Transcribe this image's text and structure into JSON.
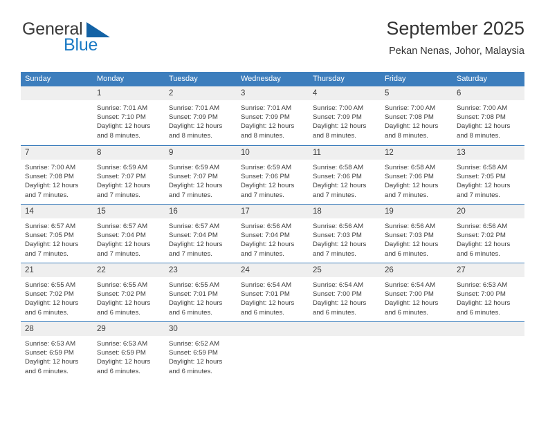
{
  "brand": {
    "word_one": "General",
    "word_two": "Blue",
    "triangle_icon": "brand-triangle-icon"
  },
  "header": {
    "title": "September 2025",
    "subtitle": "Pekan Nenas, Johor, Malaysia"
  },
  "colors": {
    "header_blue": "#3d7ebd",
    "brand_blue": "#1b7ac4",
    "brand_triangle": "#1362a5",
    "day_band_gray": "#efefef",
    "text": "#3c3c3c"
  },
  "weekdays": [
    "Sunday",
    "Monday",
    "Tuesday",
    "Wednesday",
    "Thursday",
    "Friday",
    "Saturday"
  ],
  "weeks": [
    [
      {
        "num": "",
        "lines": []
      },
      {
        "num": "1",
        "lines": [
          "Sunrise: 7:01 AM",
          "Sunset: 7:10 PM",
          "Daylight: 12 hours",
          "and 8 minutes."
        ]
      },
      {
        "num": "2",
        "lines": [
          "Sunrise: 7:01 AM",
          "Sunset: 7:09 PM",
          "Daylight: 12 hours",
          "and 8 minutes."
        ]
      },
      {
        "num": "3",
        "lines": [
          "Sunrise: 7:01 AM",
          "Sunset: 7:09 PM",
          "Daylight: 12 hours",
          "and 8 minutes."
        ]
      },
      {
        "num": "4",
        "lines": [
          "Sunrise: 7:00 AM",
          "Sunset: 7:09 PM",
          "Daylight: 12 hours",
          "and 8 minutes."
        ]
      },
      {
        "num": "5",
        "lines": [
          "Sunrise: 7:00 AM",
          "Sunset: 7:08 PM",
          "Daylight: 12 hours",
          "and 8 minutes."
        ]
      },
      {
        "num": "6",
        "lines": [
          "Sunrise: 7:00 AM",
          "Sunset: 7:08 PM",
          "Daylight: 12 hours",
          "and 8 minutes."
        ]
      }
    ],
    [
      {
        "num": "7",
        "lines": [
          "Sunrise: 7:00 AM",
          "Sunset: 7:08 PM",
          "Daylight: 12 hours",
          "and 7 minutes."
        ]
      },
      {
        "num": "8",
        "lines": [
          "Sunrise: 6:59 AM",
          "Sunset: 7:07 PM",
          "Daylight: 12 hours",
          "and 7 minutes."
        ]
      },
      {
        "num": "9",
        "lines": [
          "Sunrise: 6:59 AM",
          "Sunset: 7:07 PM",
          "Daylight: 12 hours",
          "and 7 minutes."
        ]
      },
      {
        "num": "10",
        "lines": [
          "Sunrise: 6:59 AM",
          "Sunset: 7:06 PM",
          "Daylight: 12 hours",
          "and 7 minutes."
        ]
      },
      {
        "num": "11",
        "lines": [
          "Sunrise: 6:58 AM",
          "Sunset: 7:06 PM",
          "Daylight: 12 hours",
          "and 7 minutes."
        ]
      },
      {
        "num": "12",
        "lines": [
          "Sunrise: 6:58 AM",
          "Sunset: 7:06 PM",
          "Daylight: 12 hours",
          "and 7 minutes."
        ]
      },
      {
        "num": "13",
        "lines": [
          "Sunrise: 6:58 AM",
          "Sunset: 7:05 PM",
          "Daylight: 12 hours",
          "and 7 minutes."
        ]
      }
    ],
    [
      {
        "num": "14",
        "lines": [
          "Sunrise: 6:57 AM",
          "Sunset: 7:05 PM",
          "Daylight: 12 hours",
          "and 7 minutes."
        ]
      },
      {
        "num": "15",
        "lines": [
          "Sunrise: 6:57 AM",
          "Sunset: 7:04 PM",
          "Daylight: 12 hours",
          "and 7 minutes."
        ]
      },
      {
        "num": "16",
        "lines": [
          "Sunrise: 6:57 AM",
          "Sunset: 7:04 PM",
          "Daylight: 12 hours",
          "and 7 minutes."
        ]
      },
      {
        "num": "17",
        "lines": [
          "Sunrise: 6:56 AM",
          "Sunset: 7:04 PM",
          "Daylight: 12 hours",
          "and 7 minutes."
        ]
      },
      {
        "num": "18",
        "lines": [
          "Sunrise: 6:56 AM",
          "Sunset: 7:03 PM",
          "Daylight: 12 hours",
          "and 7 minutes."
        ]
      },
      {
        "num": "19",
        "lines": [
          "Sunrise: 6:56 AM",
          "Sunset: 7:03 PM",
          "Daylight: 12 hours",
          "and 6 minutes."
        ]
      },
      {
        "num": "20",
        "lines": [
          "Sunrise: 6:56 AM",
          "Sunset: 7:02 PM",
          "Daylight: 12 hours",
          "and 6 minutes."
        ]
      }
    ],
    [
      {
        "num": "21",
        "lines": [
          "Sunrise: 6:55 AM",
          "Sunset: 7:02 PM",
          "Daylight: 12 hours",
          "and 6 minutes."
        ]
      },
      {
        "num": "22",
        "lines": [
          "Sunrise: 6:55 AM",
          "Sunset: 7:02 PM",
          "Daylight: 12 hours",
          "and 6 minutes."
        ]
      },
      {
        "num": "23",
        "lines": [
          "Sunrise: 6:55 AM",
          "Sunset: 7:01 PM",
          "Daylight: 12 hours",
          "and 6 minutes."
        ]
      },
      {
        "num": "24",
        "lines": [
          "Sunrise: 6:54 AM",
          "Sunset: 7:01 PM",
          "Daylight: 12 hours",
          "and 6 minutes."
        ]
      },
      {
        "num": "25",
        "lines": [
          "Sunrise: 6:54 AM",
          "Sunset: 7:00 PM",
          "Daylight: 12 hours",
          "and 6 minutes."
        ]
      },
      {
        "num": "26",
        "lines": [
          "Sunrise: 6:54 AM",
          "Sunset: 7:00 PM",
          "Daylight: 12 hours",
          "and 6 minutes."
        ]
      },
      {
        "num": "27",
        "lines": [
          "Sunrise: 6:53 AM",
          "Sunset: 7:00 PM",
          "Daylight: 12 hours",
          "and 6 minutes."
        ]
      }
    ],
    [
      {
        "num": "28",
        "lines": [
          "Sunrise: 6:53 AM",
          "Sunset: 6:59 PM",
          "Daylight: 12 hours",
          "and 6 minutes."
        ]
      },
      {
        "num": "29",
        "lines": [
          "Sunrise: 6:53 AM",
          "Sunset: 6:59 PM",
          "Daylight: 12 hours",
          "and 6 minutes."
        ]
      },
      {
        "num": "30",
        "lines": [
          "Sunrise: 6:52 AM",
          "Sunset: 6:59 PM",
          "Daylight: 12 hours",
          "and 6 minutes."
        ]
      },
      {
        "num": "",
        "lines": []
      },
      {
        "num": "",
        "lines": []
      },
      {
        "num": "",
        "lines": []
      },
      {
        "num": "",
        "lines": []
      }
    ]
  ]
}
